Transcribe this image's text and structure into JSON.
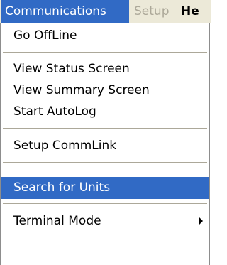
{
  "menubar": {
    "items": [
      {
        "label": "Communications"
      },
      {
        "label": "Setup"
      },
      {
        "label": "He"
      }
    ]
  },
  "menu": {
    "items": [
      {
        "label": "Go OffLine"
      },
      {
        "label": "View Status Screen"
      },
      {
        "label": "View Summary Screen"
      },
      {
        "label": "Start AutoLog"
      },
      {
        "label": "Setup CommLink"
      },
      {
        "label": "Search for Units"
      },
      {
        "label": "Terminal Mode"
      }
    ]
  },
  "colors": {
    "highlight": "#316ac5",
    "disabled_text": "#aca899",
    "menubar_bg": "#ece9d8"
  }
}
